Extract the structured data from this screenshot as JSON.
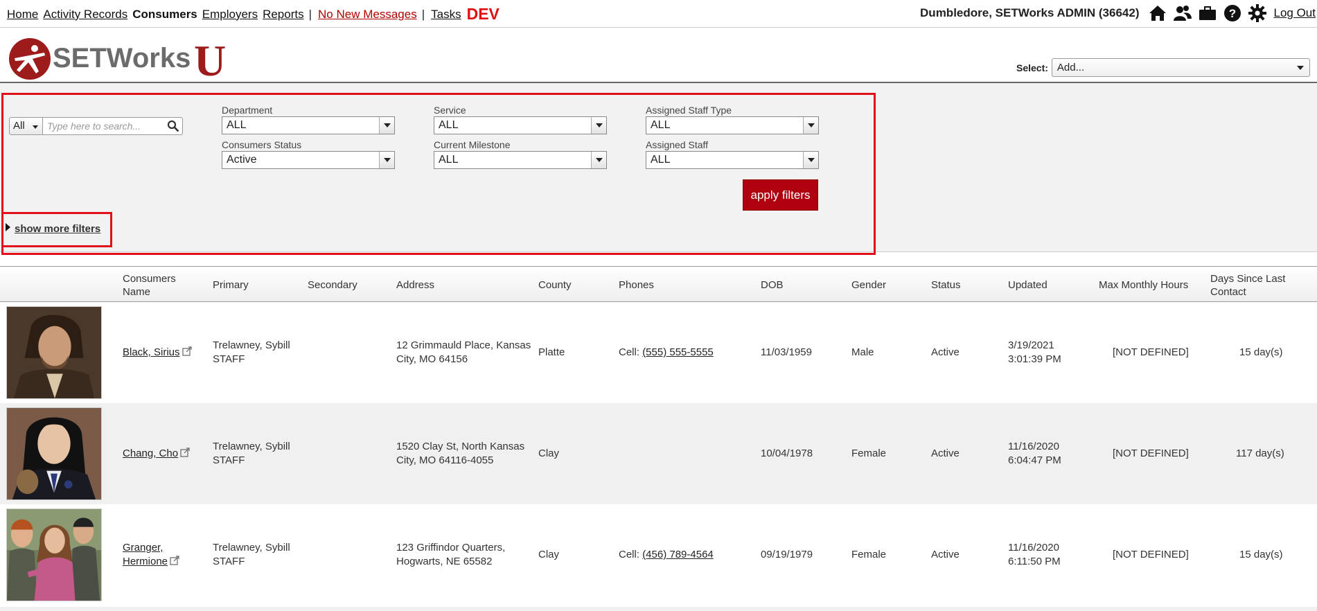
{
  "nav": {
    "items": [
      "Home",
      "Activity Records",
      "Consumers",
      "Employers",
      "Reports"
    ],
    "separator": "|",
    "messages": "No New Messages",
    "tasks": "Tasks",
    "env": "DEV"
  },
  "user": {
    "name": "Dumbledore, SETWorks ADMIN  (36642)",
    "logout": "Log Out"
  },
  "brand": {
    "name": "SETWorks",
    "suffix": "U",
    "color": "#9e1b1b"
  },
  "select": {
    "label": "Select:",
    "value": "Add..."
  },
  "search": {
    "scope": "All",
    "placeholder": "Type here to search..."
  },
  "filters": {
    "department": {
      "label": "Department",
      "value": "ALL"
    },
    "service": {
      "label": "Service",
      "value": "ALL"
    },
    "staff_type": {
      "label": "Assigned Staff Type",
      "value": "ALL"
    },
    "status": {
      "label": "Consumers Status",
      "value": "Active"
    },
    "milestone": {
      "label": "Current Milestone",
      "value": "ALL"
    },
    "staff": {
      "label": "Assigned Staff",
      "value": "ALL"
    },
    "apply": "apply filters",
    "more": "show more filters"
  },
  "table": {
    "headers": {
      "name_line1": "Consumers",
      "name_line2": "Name",
      "primary": "Primary",
      "secondary": "Secondary",
      "address": "Address",
      "county": "County",
      "phones": "Phones",
      "dob": "DOB",
      "gender": "Gender",
      "status": "Status",
      "updated": "Updated",
      "max_hours": "Max Monthly Hours",
      "days_line1": "Days Since Last",
      "days_line2": "Contact"
    },
    "rows": [
      {
        "name": "Black, Sirius",
        "primary_1": "Trelawney, Sybill",
        "primary_2": "STAFF",
        "address_1": "12 Grimmauld Place, Kansas",
        "address_2": "City, MO 64156",
        "county": "Platte",
        "phone_label": "Cell:",
        "phone": "(555) 555-5555",
        "dob": "11/03/1959",
        "gender": "Male",
        "status": "Active",
        "updated_1": "3/19/2021",
        "updated_2": "3:01:39 PM",
        "max_hours": "[NOT DEFINED]",
        "days": "15 day(s)"
      },
      {
        "name": "Chang, Cho",
        "primary_1": "Trelawney, Sybill",
        "primary_2": "STAFF",
        "address_1": "1520 Clay St, North Kansas",
        "address_2": "City, MO 64116-4055",
        "county": "Clay",
        "dob": "10/04/1978",
        "gender": "Female",
        "status": "Active",
        "updated_1": "11/16/2020",
        "updated_2": "6:04:47 PM",
        "max_hours": "[NOT DEFINED]",
        "days": "117 day(s)"
      },
      {
        "name_1": "Granger,",
        "name_2": "Hermione",
        "primary_1": "Trelawney, Sybill",
        "primary_2": "STAFF",
        "address_1": "123 Griffindor Quarters,",
        "address_2": "Hogwarts, NE 65582",
        "county": "Clay",
        "phone_label": "Cell:",
        "phone": "(456) 789-4564",
        "dob": "09/19/1979",
        "gender": "Female",
        "status": "Active",
        "updated_1": "11/16/2020",
        "updated_2": "6:11:50 PM",
        "max_hours": "[NOT DEFINED]",
        "days": "15 day(s)"
      }
    ]
  }
}
